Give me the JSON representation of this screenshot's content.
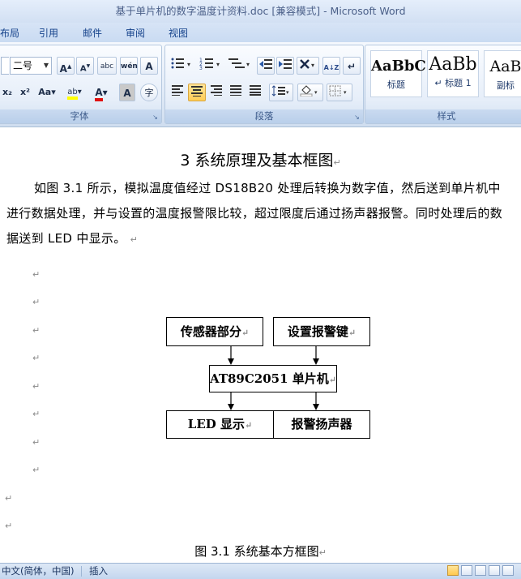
{
  "window": {
    "title": "基于单片机的数字温度计资料.doc [兼容模式] - Microsoft Word"
  },
  "ribbon": {
    "tabs": [
      "布局",
      "引用",
      "邮件",
      "审阅",
      "视图"
    ],
    "font_group": {
      "label": "字体",
      "font_size": "二号",
      "grow_font": "A",
      "shrink_font": "A",
      "phonetic": "abc",
      "enclose": "wén",
      "char_border": "A",
      "subscript": "x₂",
      "superscript": "x²",
      "change_case": "Aa",
      "highlight": "ab",
      "font_color": "A",
      "char_shading": "A",
      "enclose_char": "字"
    },
    "paragraph_group": {
      "label": "段落",
      "sort": "A↓Z",
      "show_marks": "↵"
    },
    "styles_group": {
      "label": "样式",
      "styles": [
        {
          "sample": "AaBbC",
          "name": "标题"
        },
        {
          "sample": "AaBb",
          "name": "↵ 标题 1"
        },
        {
          "sample": "AaB",
          "name": "副标"
        }
      ]
    }
  },
  "document": {
    "heading": "3 系统原理及基本框图",
    "paragraph": "如图 3.1 所示，模拟温度值经过 DS18B20 处理后转换为数字值，然后送到单片机中进行数据处理，并与设置的温度报警限比较，超过限度后通过扬声器报警。同时处理后的数据送到 LED 中显示。",
    "paragraph_mark": "↵",
    "diagram": {
      "sensor": "传感器部分",
      "alarm_key": "设置报警键",
      "mcu": "AT89C2051 单片机",
      "led": "LED 显示",
      "speaker": "报警扬声器"
    },
    "caption": "图 3.1 系统基本方框图"
  },
  "statusbar": {
    "language": "中文(简体，中国)",
    "mode": "插入"
  }
}
